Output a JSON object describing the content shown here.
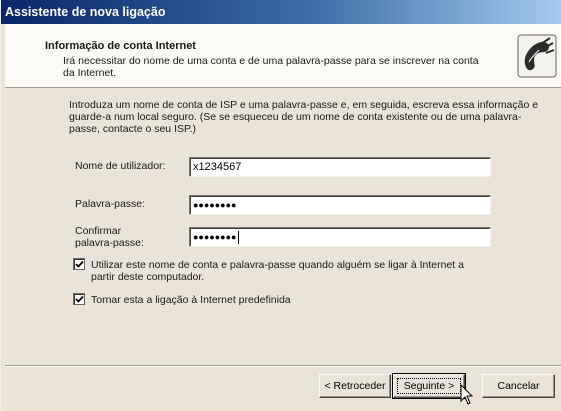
{
  "window": {
    "title": "Assistente de nova ligação"
  },
  "header": {
    "title": "Informação de conta Internet",
    "description": "Irá necessitar do nome de uma conta e de uma palavra-passe para se inscrever na conta da Internet.",
    "icon": "phone-connection-icon"
  },
  "body": {
    "intro": "Introduza um nome de conta de ISP e uma palavra-passe e, em seguida, escreva essa informação e guarde-a num local seguro. (Se se esqueceu de um nome de conta existente ou de uma palavra-passe, contacte o seu ISP.)",
    "username": {
      "label": "Nome de utilizador:",
      "value": "x1234567"
    },
    "password": {
      "label": "Palavra-passe:",
      "value": "●●●●●●●●"
    },
    "confirm": {
      "label_line1": "Confirmar",
      "label_line2": "palavra-passe:",
      "value": "●●●●●●●●"
    },
    "options": [
      {
        "label_line1": "Utilizar este nome de conta e palavra-passe quando alguém se ligar à Internet a",
        "label_line2": "partir deste computador.",
        "checked": true
      },
      {
        "label_line1": "Tornar esta a ligação à Internet predefinida",
        "checked": true
      }
    ]
  },
  "buttons": {
    "back": "< Retroceder",
    "next": "Seguinte >",
    "cancel": "Cancelar"
  },
  "colors": {
    "title_bar_start": "#0a246a",
    "title_bar_end": "#a6caf0",
    "dialog_face": "#e9e3d8",
    "header_bg": "#fbfaf6"
  }
}
